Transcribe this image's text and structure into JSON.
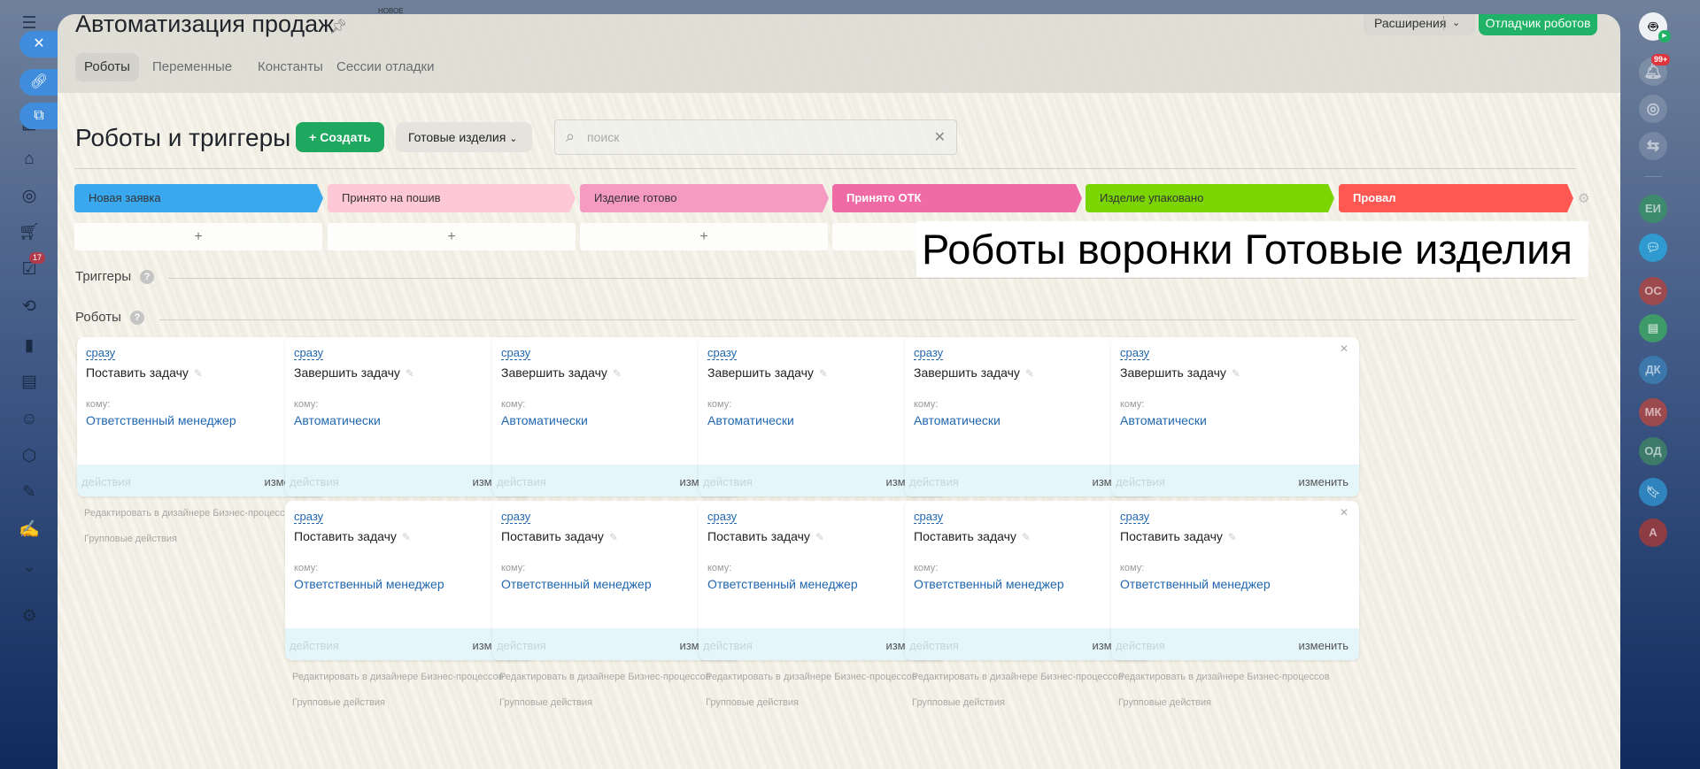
{
  "background": {
    "new_label": "НОВОЕ"
  },
  "header": {
    "title": "Автоматизация продаж",
    "tabs": [
      {
        "label": "Роботы",
        "active": true
      },
      {
        "label": "Переменные",
        "active": false
      },
      {
        "label": "Константы",
        "active": false
      },
      {
        "label": "Сессии отладки",
        "active": false
      }
    ],
    "extensions_label": "Расширения",
    "debugger_label": "Отладчик роботов"
  },
  "toolbar": {
    "section_title": "Роботы и триггеры",
    "create_label": "Создать",
    "funnel_label": "Готовые изделия",
    "search_placeholder": "поиск"
  },
  "stages": [
    {
      "label": "Новая заявка",
      "color": "#39a8ef",
      "text": "#333"
    },
    {
      "label": "Принято на пошив",
      "color": "#ffc8d6",
      "text": "#333"
    },
    {
      "label": "Изделие готово",
      "color": "#f59ac1",
      "text": "#333"
    },
    {
      "label": "Принято ОТК",
      "color": "#f06aa6",
      "text": "#fff"
    },
    {
      "label": "Изделие упаковано",
      "color": "#7bd500",
      "text": "#333"
    },
    {
      "label": "Провал",
      "color": "#ff5752",
      "text": "#fff"
    }
  ],
  "add_label": "+",
  "overlay_caption": "Роботы воронки Готовые изделия",
  "triggers_label": "Триггеры",
  "robots_label": "Роботы",
  "card_labels": {
    "when": "сразу",
    "to": "кому:",
    "actions": "действия",
    "edit": "изменить"
  },
  "columns": [
    {
      "robots": [
        {
          "name": "Поставить задачу",
          "to": "Ответственный менеджер"
        }
      ]
    },
    {
      "robots": [
        {
          "name": "Завершить задачу",
          "to": "Автоматически"
        },
        {
          "name": "Поставить задачу",
          "to": "Ответственный менеджер"
        }
      ]
    },
    {
      "robots": [
        {
          "name": "Завершить задачу",
          "to": "Автоматически"
        },
        {
          "name": "Поставить задачу",
          "to": "Ответственный менеджер"
        }
      ]
    },
    {
      "robots": [
        {
          "name": "Завершить задачу",
          "to": "Автоматически"
        },
        {
          "name": "Поставить задачу",
          "to": "Ответственный менеджер"
        }
      ]
    },
    {
      "robots": [
        {
          "name": "Завершить задачу",
          "to": "Автоматически"
        },
        {
          "name": "Поставить задачу",
          "to": "Ответственный менеджер"
        }
      ]
    },
    {
      "robots": [
        {
          "name": "Завершить задачу",
          "to": "Автоматически"
        },
        {
          "name": "Поставить задачу",
          "to": "Ответственный менеджер"
        }
      ]
    }
  ],
  "column_links": {
    "designer": "Редактировать в дизайнере Бизнес-процессов",
    "group": "Групповые действия"
  },
  "left_sidebar": {
    "tasks_badge": "17"
  },
  "right_sidebar": {
    "notifications_badge": "99+",
    "contacts": [
      {
        "initials": "ЕИ",
        "color": "#3e8a6e"
      },
      {
        "initials": "",
        "color": "#2f9ad0",
        "icon": "chat"
      },
      {
        "initials": "ОС",
        "color": "#9c4a4e"
      },
      {
        "initials": "",
        "color": "#3e9a68",
        "icon": "news"
      },
      {
        "initials": "ДК",
        "color": "#3d78ad"
      },
      {
        "initials": "МК",
        "color": "#9c4a4e"
      },
      {
        "initials": "ОД",
        "color": "#3e7a6a"
      },
      {
        "initials": "",
        "color": "#2f84bd",
        "icon": "bookmark"
      },
      {
        "initials": "А",
        "color": "#8e3c44"
      }
    ]
  }
}
